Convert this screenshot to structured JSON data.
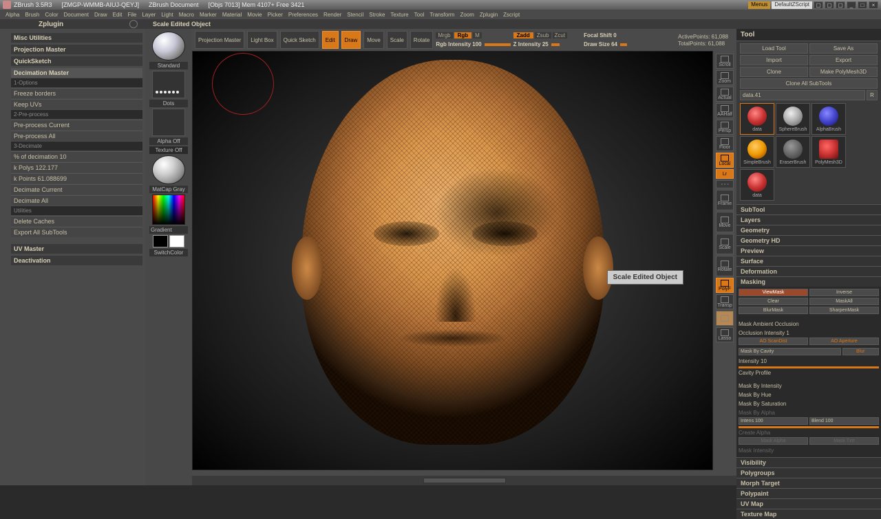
{
  "titlebar": {
    "app": "ZBrush 3.5R3",
    "proj": "[ZMGP-WMMB-AIUJ-QEYJ]",
    "doc": "ZBrush Document",
    "stats": "[Objs 7013] Mem 4107+ Free 3421",
    "menus": "Menus",
    "dscript": "DefaultZScript"
  },
  "menu": [
    "Alpha",
    "Brush",
    "Color",
    "Document",
    "Draw",
    "Edit",
    "File",
    "Layer",
    "Light",
    "Macro",
    "Marker",
    "Material",
    "Movie",
    "Picker",
    "Preferences",
    "Render",
    "Stencil",
    "Stroke",
    "Texture",
    "Tool",
    "Transform",
    "Zoom",
    "Zplugin",
    "Zscript"
  ],
  "row2": {
    "title": "Zplugin",
    "status": "Scale Edited Object"
  },
  "left": {
    "items1": [
      "Misc Utilities",
      "Projection Master",
      "QuickSketch"
    ],
    "decHdr": "Decimation Master",
    "opts": "1-Options",
    "opts_items": [
      "Freeze borders",
      "Keep UVs"
    ],
    "pre": "2-Pre-process",
    "pre_items": [
      "Pre-process Current",
      "Pre-process All"
    ],
    "dec": "3-Decimate",
    "dec_items": [
      "% of decimation 10",
      "k Polys 122.177",
      "k Points 61.088699",
      "Decimate Current",
      "Decimate All"
    ],
    "util": "Utilities",
    "util_items": [
      "Delete Caches",
      "Export All SubTools"
    ],
    "tail": [
      "UV Master",
      "Deactivation"
    ]
  },
  "strip": {
    "brush": "Standard",
    "stroke": "Dots",
    "alpha": "Alpha Off",
    "material": "MatCap Gray",
    "gradient": "Gradient",
    "switch": "SwitchColor"
  },
  "toolbar": {
    "proj": "Projection Master",
    "light": "Light Box",
    "quick": "Quick Sketch",
    "edit": "Edit",
    "draw": "Draw",
    "move": "Move",
    "scale": "Scale",
    "rot": "Rotate",
    "mrgb": "Mrgb",
    "rgb": "Rgb",
    "m": "M",
    "rgbint": "Rgb Intensity 100",
    "zadd": "Zadd",
    "zsub": "Zsub",
    "zcut": "Zcut",
    "zint": "Z Intensity 25",
    "focal": "Focal Shift 0",
    "drawsize": "Draw Size 64",
    "active": "ActivePoints: 61,088",
    "total": "TotalPoints: 61,088"
  },
  "ricons": [
    "Scroll",
    "Zoom",
    "Actual",
    "AAHalf",
    "Persp",
    "Floor",
    "Local",
    "Lr",
    "Frame",
    "Move",
    "Scale",
    "Rotate",
    "PolyF",
    "Transp",
    "Ghost",
    "Lasso"
  ],
  "tooltip": "Scale Edited Object",
  "right": {
    "hdr": "Tool",
    "row1": [
      "Load Tool",
      "Save As"
    ],
    "row2": [
      "Import",
      "Export"
    ],
    "row3": [
      "Clone",
      "Make PolyMesh3D"
    ],
    "row4": "Clone All SubTools",
    "row5l": "data.41",
    "row5r": "R",
    "thumbs": [
      "data",
      "SphereBrush",
      "AlphaBrush",
      "SimpleBrush",
      "EraserBrush",
      "PolyMesh3D",
      "data"
    ],
    "sections": [
      "SubTool",
      "Layers",
      "Geometry",
      "Geometry HD",
      "Preview",
      "Surface",
      "Deformation",
      "Masking"
    ],
    "mask": {
      "r1": [
        "ViewMask",
        "Inverse"
      ],
      "r2": [
        "Clear",
        "MaskAll"
      ],
      "r3": [
        "BlurMask",
        "SharpenMask"
      ],
      "ao": "Mask Ambient Occlusion",
      "occ": "Occlusion Intensity 1",
      "ao2": [
        "AO ScanDist",
        "AO Aperture"
      ],
      "cav": "Mask By Cavity",
      "blur": "Blur",
      "cavint": "Intensity 10",
      "cavprof": "Cavity Profile",
      "mint": "Mask By Intensity",
      "mhue": "Mask By Hue",
      "msat": "Mask By Saturation",
      "malpha": "Mask By Alpha",
      "intens": "Intens 100",
      "blend": "Blend 100",
      "calpha": "Create Alpha",
      "malpha2": "Mask Alpha",
      "mtxt": "Mask Txtr",
      "mintens": "Mask Intensity"
    },
    "tail": [
      "Visibility",
      "Polygroups",
      "Morph Target",
      "Polypaint",
      "UV Map",
      "Texture Map"
    ]
  }
}
